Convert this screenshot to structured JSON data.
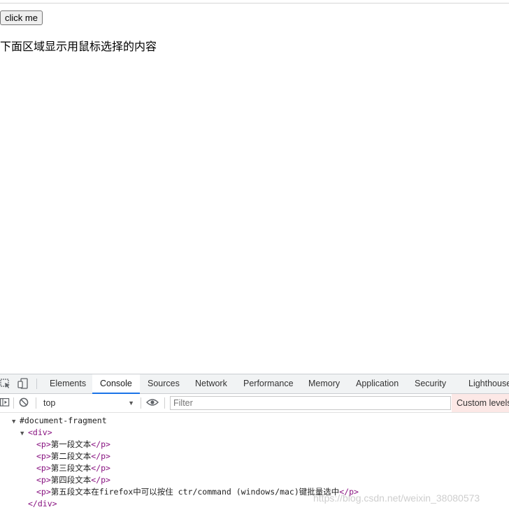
{
  "page": {
    "button_label": "click me",
    "instruction": "下面区域显示用鼠标选择的内容"
  },
  "devtools": {
    "tabs": [
      {
        "label": "Elements",
        "active": false
      },
      {
        "label": "Console",
        "active": true
      },
      {
        "label": "Sources",
        "active": false
      },
      {
        "label": "Network",
        "active": false
      },
      {
        "label": "Performance",
        "active": false
      },
      {
        "label": "Memory",
        "active": false
      },
      {
        "label": "Application",
        "active": false
      },
      {
        "label": "Security",
        "active": false
      },
      {
        "label": "Lighthouse",
        "active": false
      }
    ],
    "context": "top",
    "filter_placeholder": "Filter",
    "levels_label": "Custom levels",
    "accent": "#1a73e8",
    "tag_color": "#881280",
    "output": {
      "fragment": "#document-fragment",
      "div_open": "<div>",
      "div_close": "</div>",
      "p_open": "<p>",
      "p_close": "</p>",
      "paragraphs": [
        "第一段文本",
        "第二段文本",
        "第三段文本",
        "第四段文本",
        "第五段文本在firefox中可以按住 ctr/command (windows/mac)键批量选中"
      ]
    }
  },
  "watermark": "https://blog.csdn.net/weixin_38080573"
}
